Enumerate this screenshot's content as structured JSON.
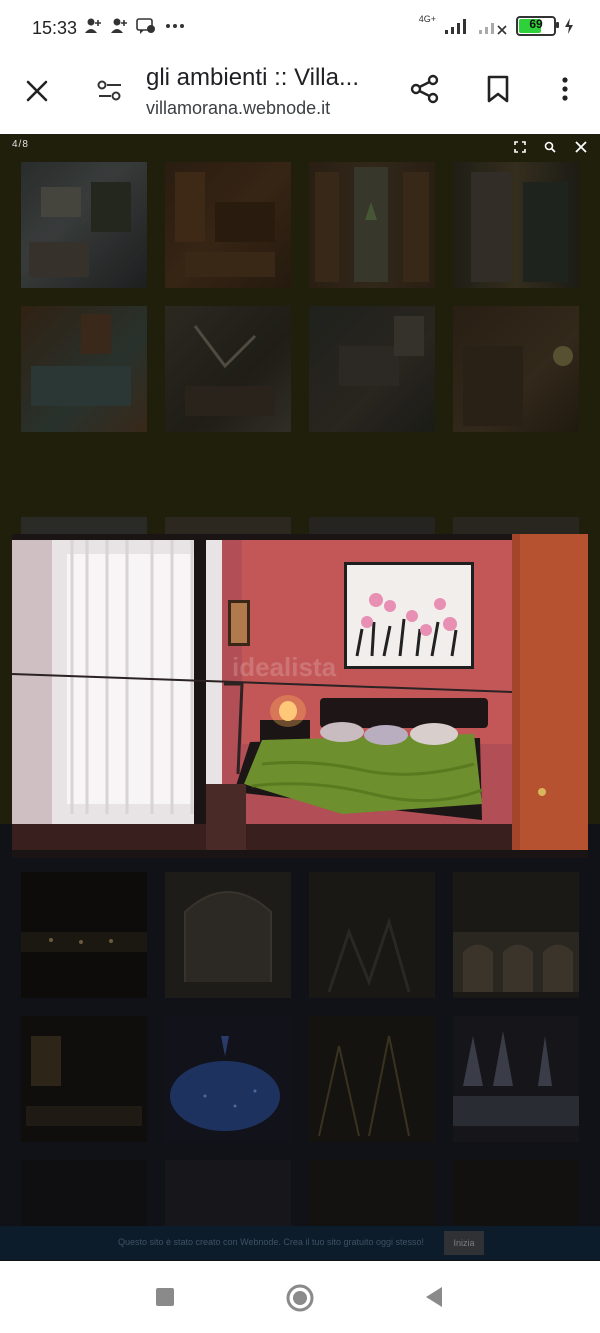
{
  "status_bar": {
    "time": "15:33",
    "network": "4G+",
    "battery_percent": "69",
    "battery_level": 0.69
  },
  "app_bar": {
    "title": "gli ambienti :: Villa...",
    "url": "villamorana.webnode.it"
  },
  "gallery": {
    "counter": "4/8"
  },
  "footer": {
    "message": "Questo sito è stato creato con Webnode. Crea il tuo sito gratuito oggi stesso!",
    "button_label": "Inizia"
  },
  "watermark": "idealista",
  "colors": {
    "wall": "#c35757",
    "bedspread": "#6e8f2e",
    "footer_bg": "#0d1c2a",
    "battery_fill": "#2fd13a"
  }
}
